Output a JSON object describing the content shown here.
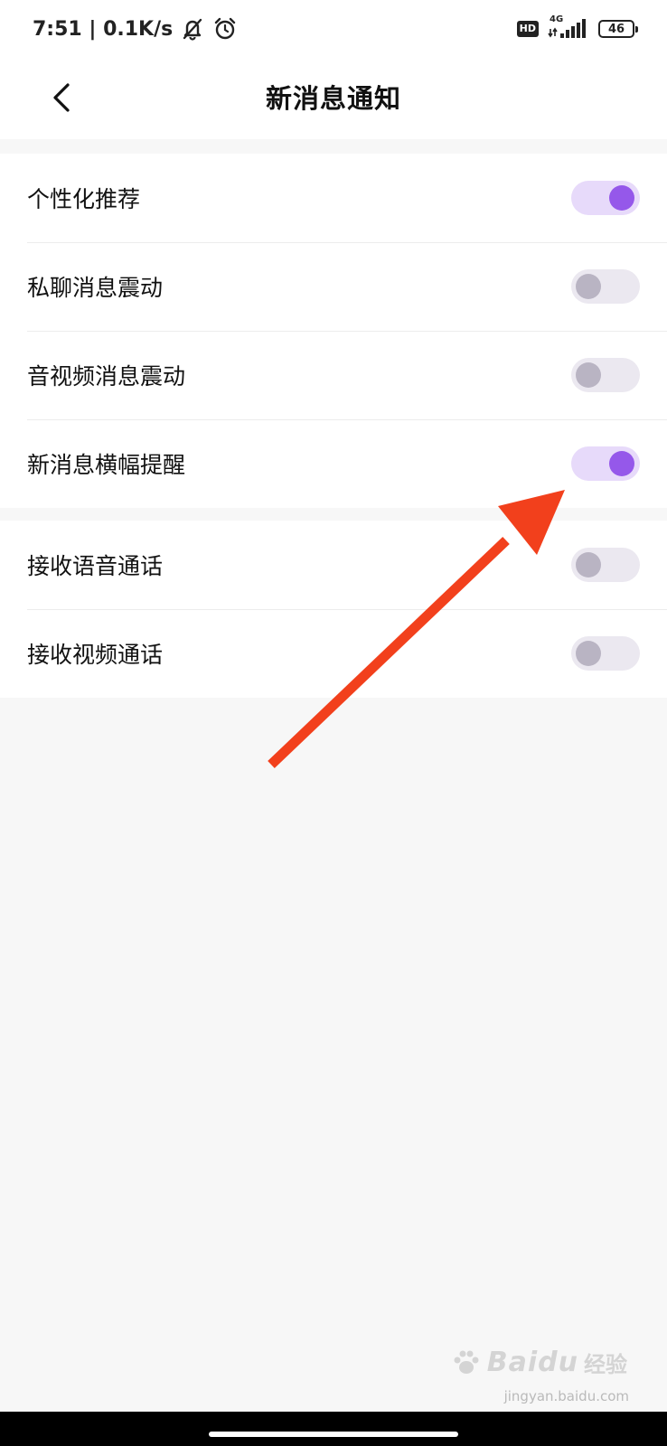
{
  "status_bar": {
    "time_speed": "7:51 | 0.1K/s",
    "hd": "HD",
    "network": "4G",
    "battery": "46"
  },
  "header": {
    "title": "新消息通知"
  },
  "groups": [
    {
      "items": [
        {
          "label": "个性化推荐",
          "enabled": true
        },
        {
          "label": "私聊消息震动",
          "enabled": false
        },
        {
          "label": "音视频消息震动",
          "enabled": false
        },
        {
          "label": "新消息横幅提醒",
          "enabled": true
        }
      ]
    },
    {
      "items": [
        {
          "label": "接收语音通话",
          "enabled": false
        },
        {
          "label": "接收视频通话",
          "enabled": false
        }
      ]
    }
  ],
  "colors": {
    "toggle_on_track": "#e7dafa",
    "toggle_on_knob": "#9558ea",
    "toggle_off_track": "#ebe8f0",
    "toggle_off_knob": "#b9b4c3",
    "annotation_arrow": "#f2401c"
  },
  "watermark": {
    "brand": "Baidu",
    "cn": "经验",
    "url": "jingyan.baidu.com"
  }
}
